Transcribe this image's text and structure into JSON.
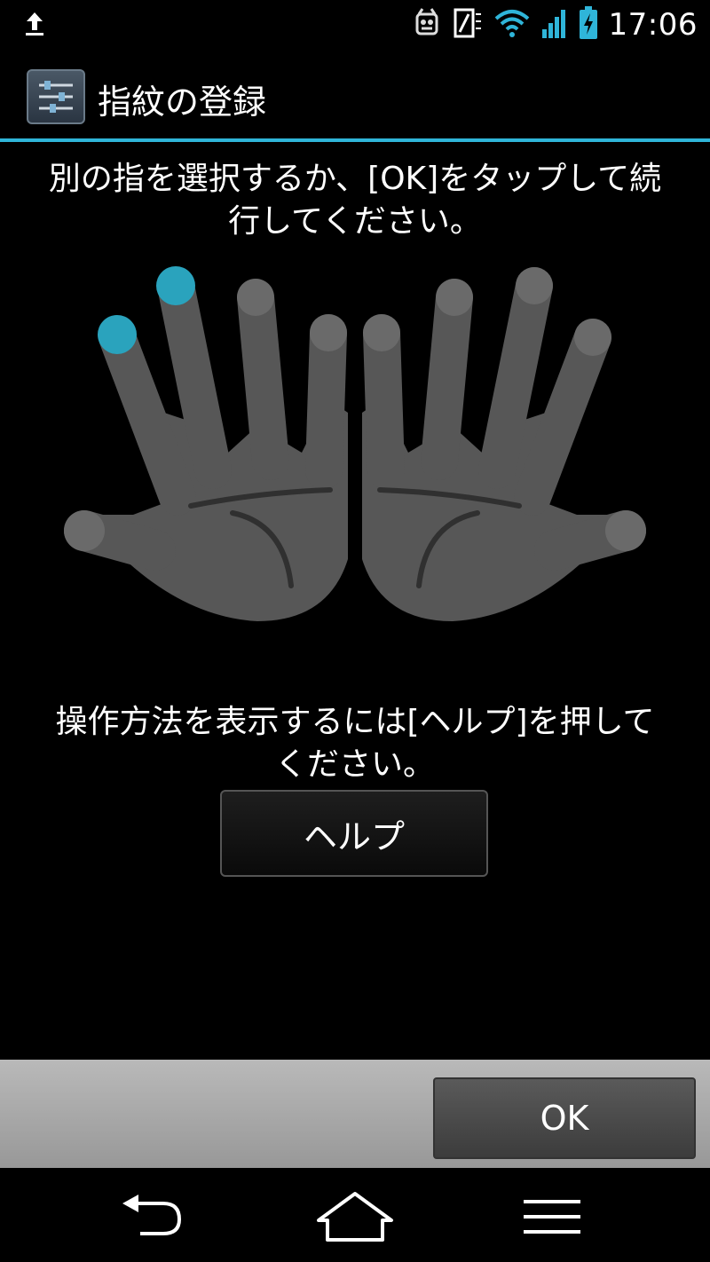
{
  "status_bar": {
    "time": "17:06",
    "icons": [
      "upload-icon",
      "notification-icon",
      "sim-icon",
      "wifi-icon",
      "signal-icon",
      "battery-charging-icon"
    ]
  },
  "action_bar": {
    "title": "指紋の登録",
    "icon": "settings-icon"
  },
  "main": {
    "instruction_line1": "別の指を選択するか、[OK]をタップして続",
    "instruction_line2": "行してください。",
    "help_text_line1": "操作方法を表示するには[ヘルプ]を押して",
    "help_text_line2": "ください。",
    "help_button_label": "ヘルプ",
    "hands": {
      "left_hand_fingers": [
        "thumb",
        "index",
        "middle",
        "ring",
        "pinky"
      ],
      "right_hand_fingers": [
        "thumb",
        "index",
        "middle",
        "ring",
        "pinky"
      ],
      "registered_fingers": [
        "left-pinky",
        "left-ring"
      ],
      "highlight_color": "#2aa3bd",
      "hand_color": "#575757"
    }
  },
  "footer": {
    "ok_label": "OK"
  },
  "nav_bar": {
    "items": [
      "back-icon",
      "home-icon",
      "menu-icon"
    ]
  },
  "colors": {
    "accent": "#2fb5d9",
    "background": "#000000"
  }
}
